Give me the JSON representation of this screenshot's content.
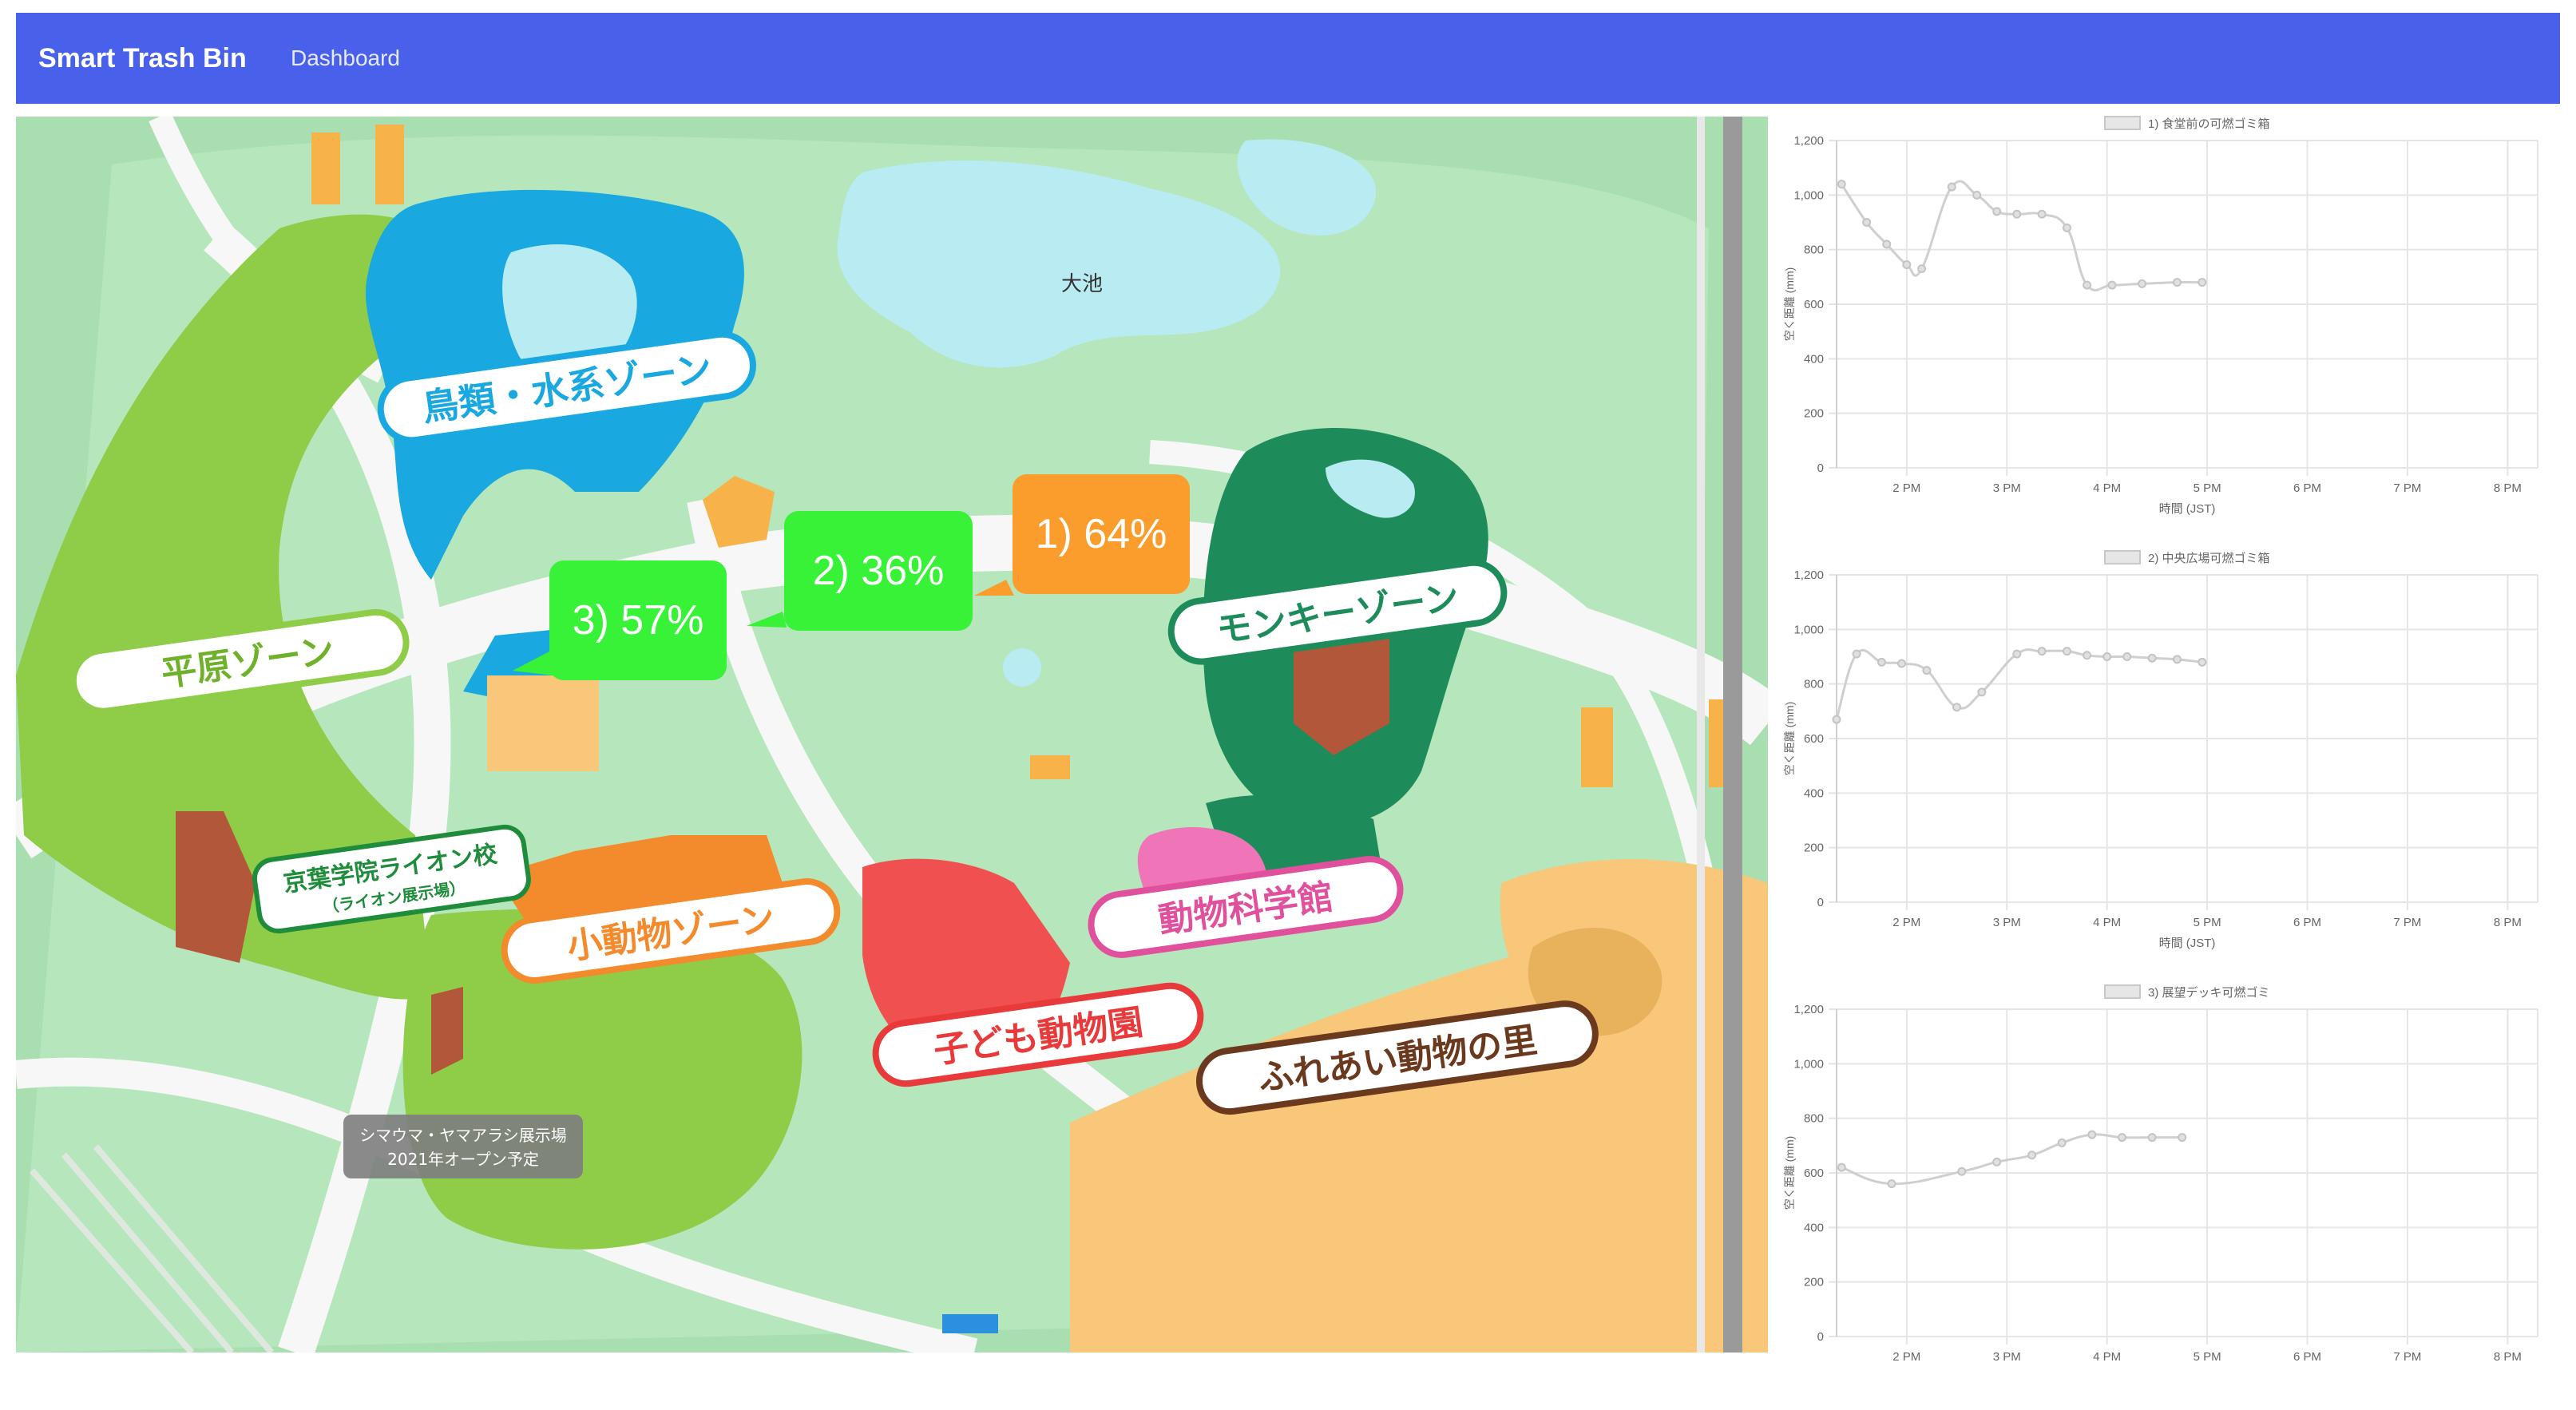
{
  "navbar": {
    "brand": "Smart Trash Bin",
    "dashboard_link": "Dashboard"
  },
  "colors": {
    "navbar": "#4961ea",
    "orange_callout": "#fb9d2c",
    "green_callout": "#38f238",
    "line": "#cfcfcf"
  },
  "map": {
    "pond_label": "大池",
    "zones": {
      "birds_water": "鳥類・水系ゾーン",
      "plains": "平原ゾーン",
      "monkey": "モンキーゾーン",
      "lion_school": "京葉学院ライオン校",
      "lion_sub": "（ライオン展示場）",
      "small_animals": "小動物ゾーン",
      "science": "動物科学館",
      "kids_zoo": "子ども動物園",
      "petting": "ふれあい動物の里"
    },
    "notice_line1": "シマウマ・ヤマアラシ展示場",
    "notice_line2": "2021年オープン予定",
    "callouts": [
      {
        "label": "1) 64%",
        "color": "orange"
      },
      {
        "label": "2) 36%",
        "color": "green"
      },
      {
        "label": "3) 57%",
        "color": "green"
      }
    ]
  },
  "chart_data": [
    {
      "type": "line",
      "title": "1) 食堂前の可燃ゴミ箱",
      "xlabel": "時間 (JST)",
      "ylabel": "空く距離 (mm)",
      "ylim": [
        0,
        1200
      ],
      "yticks": [
        "0",
        "200",
        "400",
        "600",
        "800",
        "1,000",
        "1,200"
      ],
      "xticks": [
        "2 PM",
        "3 PM",
        "4 PM",
        "5 PM",
        "6 PM",
        "7 PM",
        "8 PM"
      ],
      "xlim": [
        13.3,
        20.3
      ],
      "legend": "top",
      "x": [
        13.35,
        13.6,
        13.8,
        14.0,
        14.15,
        14.45,
        14.7,
        14.9,
        15.1,
        15.35,
        15.6,
        15.8,
        16.05,
        16.35,
        16.7,
        16.95
      ],
      "values": [
        1040,
        900,
        820,
        745,
        730,
        1030,
        1000,
        940,
        930,
        930,
        880,
        670,
        670,
        675,
        680,
        680
      ]
    },
    {
      "type": "line",
      "title": "2) 中央広場可燃ゴミ箱",
      "xlabel": "時間 (JST)",
      "ylabel": "空く距離 (mm)",
      "ylim": [
        0,
        1200
      ],
      "yticks": [
        "0",
        "200",
        "400",
        "600",
        "800",
        "1,000",
        "1,200"
      ],
      "xticks": [
        "2 PM",
        "3 PM",
        "4 PM",
        "5 PM",
        "6 PM",
        "7 PM",
        "8 PM"
      ],
      "xlim": [
        13.3,
        20.3
      ],
      "legend": "top",
      "x": [
        13.3,
        13.5,
        13.75,
        13.95,
        14.2,
        14.5,
        14.75,
        15.1,
        15.35,
        15.6,
        15.8,
        16.0,
        16.2,
        16.45,
        16.7,
        16.95
      ],
      "values": [
        670,
        910,
        880,
        875,
        850,
        715,
        770,
        910,
        920,
        920,
        905,
        900,
        900,
        895,
        890,
        880
      ]
    },
    {
      "type": "line",
      "title": "3) 展望デッキ可燃ゴミ",
      "xlabel": "",
      "ylabel": "空く距離 (mm)",
      "ylim": [
        0,
        1200
      ],
      "yticks": [
        "0",
        "200",
        "400",
        "600",
        "800",
        "1,000",
        "1,200"
      ],
      "xticks": [
        "2 PM",
        "3 PM",
        "4 PM",
        "5 PM",
        "6 PM",
        "7 PM",
        "8 PM"
      ],
      "xlim": [
        13.3,
        20.3
      ],
      "legend": "top",
      "x": [
        13.35,
        13.85,
        14.55,
        14.9,
        15.25,
        15.55,
        15.85,
        16.15,
        16.45,
        16.75
      ],
      "values": [
        620,
        560,
        605,
        640,
        665,
        710,
        740,
        730,
        730,
        730
      ]
    }
  ]
}
